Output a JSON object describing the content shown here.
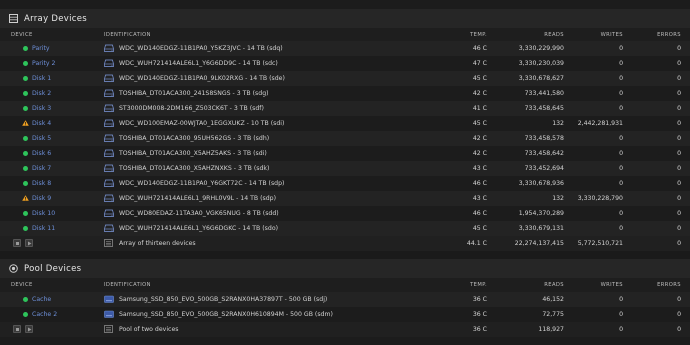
{
  "array": {
    "title": "Array Devices",
    "columns": {
      "device": "DEVICE",
      "identification": "IDENTIFICATION",
      "temp": "TEMP.",
      "reads": "READS",
      "writes": "WRITES",
      "errors": "ERRORS"
    },
    "rows": [
      {
        "status": "ok",
        "name": "Parity",
        "ident": "WDC_WD140EDGZ-11B1PA0_Y5KZ3JVC - 14 TB (sdq)",
        "temp": "46 C",
        "reads": "3,330,229,990",
        "writes": "0",
        "errors": "0"
      },
      {
        "status": "ok",
        "name": "Parity 2",
        "ident": "WDC_WUH721414ALE6L1_Y6G6DD9C - 14 TB (sdc)",
        "temp": "47 C",
        "reads": "3,330,230,039",
        "writes": "0",
        "errors": "0"
      },
      {
        "status": "ok",
        "name": "Disk 1",
        "ident": "WDC_WD140EDGZ-11B1PA0_9LK02RXG - 14 TB (sde)",
        "temp": "45 C",
        "reads": "3,330,678,627",
        "writes": "0",
        "errors": "0"
      },
      {
        "status": "ok",
        "name": "Disk 2",
        "ident": "TOSHIBA_DT01ACA300_241S8SNGS - 3 TB (sdg)",
        "temp": "42 C",
        "reads": "733,441,580",
        "writes": "0",
        "errors": "0"
      },
      {
        "status": "ok",
        "name": "Disk 3",
        "ident": "ST3000DM008-2DM166_Z503CK6T - 3 TB (sdf)",
        "temp": "41 C",
        "reads": "733,458,645",
        "writes": "0",
        "errors": "0"
      },
      {
        "status": "warn",
        "name": "Disk 4",
        "ident": "WDC_WD100EMAZ-00WJTA0_1EGGXUKZ - 10 TB (sdi)",
        "temp": "45 C",
        "reads": "132",
        "writes": "2,442,281,931",
        "errors": "0"
      },
      {
        "status": "ok",
        "name": "Disk 5",
        "ident": "TOSHIBA_DT01ACA300_95UH562GS - 3 TB (sdh)",
        "temp": "42 C",
        "reads": "733,458,578",
        "writes": "0",
        "errors": "0"
      },
      {
        "status": "ok",
        "name": "Disk 6",
        "ident": "TOSHIBA_DT01ACA300_X5AHZ5AKS - 3 TB (sdi)",
        "temp": "42 C",
        "reads": "733,458,642",
        "writes": "0",
        "errors": "0"
      },
      {
        "status": "ok",
        "name": "Disk 7",
        "ident": "TOSHIBA_DT01ACA300_X5AHZNXKS - 3 TB (sdk)",
        "temp": "43 C",
        "reads": "733,452,694",
        "writes": "0",
        "errors": "0"
      },
      {
        "status": "ok",
        "name": "Disk 8",
        "ident": "WDC_WD140EDGZ-11B1PA0_Y6GKT72C - 14 TB (sdp)",
        "temp": "46 C",
        "reads": "3,330,678,936",
        "writes": "0",
        "errors": "0"
      },
      {
        "status": "warn",
        "name": "Disk 9",
        "ident": "WDC_WUH721414ALE6L1_9RHL0V9L - 14 TB (sdp)",
        "temp": "43 C",
        "reads": "132",
        "writes": "3,330,228,790",
        "errors": "0"
      },
      {
        "status": "ok",
        "name": "Disk 10",
        "ident": "WDC_WD80EDAZ-11TA3A0_VGK65NUG - 8 TB (sdd)",
        "temp": "46 C",
        "reads": "1,954,370,289",
        "writes": "0",
        "errors": "0"
      },
      {
        "status": "ok",
        "name": "Disk 11",
        "ident": "WDC_WUH721414ALE6L1_Y6G6DGKC - 14 TB (sdo)",
        "temp": "45 C",
        "reads": "3,330,679,131",
        "writes": "0",
        "errors": "0"
      }
    ],
    "summary": {
      "label": "Array of thirteen devices",
      "temp": "44.1 C",
      "reads": "22,274,137,415",
      "writes": "5,772,510,721",
      "errors": "0"
    }
  },
  "pool": {
    "title": "Pool Devices",
    "columns": {
      "device": "DEVICE",
      "identification": "IDENTIFICATION",
      "temp": "TEMP.",
      "reads": "READS",
      "writes": "WRITES",
      "errors": "ERRORS"
    },
    "rows": [
      {
        "status": "ok",
        "name": "Cache",
        "ident": "Samsung_SSD_850_EVO_500GB_S2RANX0HA37897T - 500 GB (sdj)",
        "temp": "36 C",
        "reads": "46,152",
        "writes": "0",
        "errors": "0"
      },
      {
        "status": "ok",
        "name": "Cache 2",
        "ident": "Samsung_SSD_850_EVO_500GB_S2RANX0H610894M - 500 GB (sdm)",
        "temp": "36 C",
        "reads": "72,775",
        "writes": "0",
        "errors": "0"
      }
    ],
    "summary": {
      "label": "Pool of two devices",
      "temp": "36 C",
      "reads": "118,927",
      "writes": "0",
      "errors": "0"
    }
  },
  "colors": {
    "ok": "#2ec45b",
    "warn": "#f0a020",
    "link": "#6d8fd8"
  },
  "icons": {
    "array_header": "grid-icon",
    "pool_header": "pool-circle-icon",
    "device": "hard-drive-icon",
    "summary": "list-icon",
    "ssd": "ssd-icon"
  }
}
